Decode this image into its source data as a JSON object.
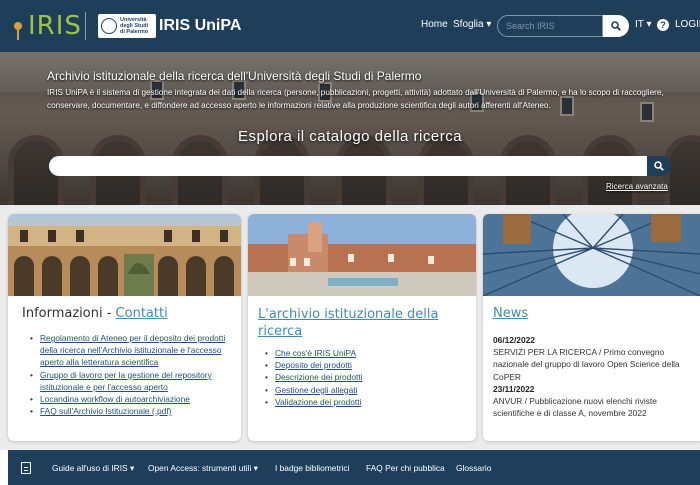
{
  "nav": {
    "brand_iris": "IRIS",
    "logo_text": "Università\ndegli Studi\ndi Palermo",
    "brand_title": "IRIS UniPA",
    "home": "Home",
    "browse": "Sfoglia ▾",
    "search_placeholder": "Search IRIS",
    "lang": "IT ▾",
    "help": "?",
    "login": "LOGIN"
  },
  "hero": {
    "title": "Archivio istituzionale della ricerca dell'Università degli Studi di Palermo",
    "description": "IRIS UniPA è il sistema di gestione integrata dei dati della ricerca (persone, pubblicazioni, progetti, attività) adottato dall'Università di Palermo, e ha lo scopo di raccogliere, conservare, documentare, e diffondere ad accesso aperto le informazioni relative alla produzione scientifica degli autori afferenti all'Ateneo.",
    "explore": "Esplora il catalogo della ricerca",
    "search_value": "",
    "advanced": "Ricerca avanzata"
  },
  "cards": {
    "info": {
      "title_prefix": "Informazioni - ",
      "title_link": "Contatti",
      "links": [
        "Regolamento di Ateneo per il deposito dei prodotti della ricerca nell'Archivio istituzionale e l'accesso aperto alla letteratura scientifica",
        "Gruppo di lavoro per la gestione del repository istituzionale e per l'accesso aperto",
        "Locandina workflow di autoarchiviazione",
        "FAQ sull'Archivio Istituzionale (.pdf)"
      ]
    },
    "archive": {
      "title": "L'archivio istituzionale della ricerca",
      "links": [
        "Che cos'è IRIS UniPA",
        "Deposito dei prodotti",
        "Descrizione dei prodotti",
        "Gestione degli allegati",
        "Validazione dei prodotti"
      ]
    },
    "news": {
      "title": "News",
      "items": [
        {
          "date": "06/12/2022",
          "text": "SERVIZI PER LA RICERCA / Primo convegno nazionale del gruppo di lavoro Open Science della CoPER"
        },
        {
          "date": "23/11/2022",
          "text": "ANVUR / Pubblicazione nuovi elenchi riviste scientifiche e di classe A, novembre 2022"
        }
      ]
    }
  },
  "footer": {
    "items": [
      "Guide all'uso di IRIS ▾",
      "Open Access: strumenti utili ▾",
      "I badge bibliometrici",
      "FAQ Per chi pubblica",
      "Glossario"
    ]
  },
  "colors": {
    "navbar": "#1f3e5a",
    "brand_green": "#9ec43e",
    "link": "#1f4f86",
    "heading_link": "#3f8bb3"
  }
}
